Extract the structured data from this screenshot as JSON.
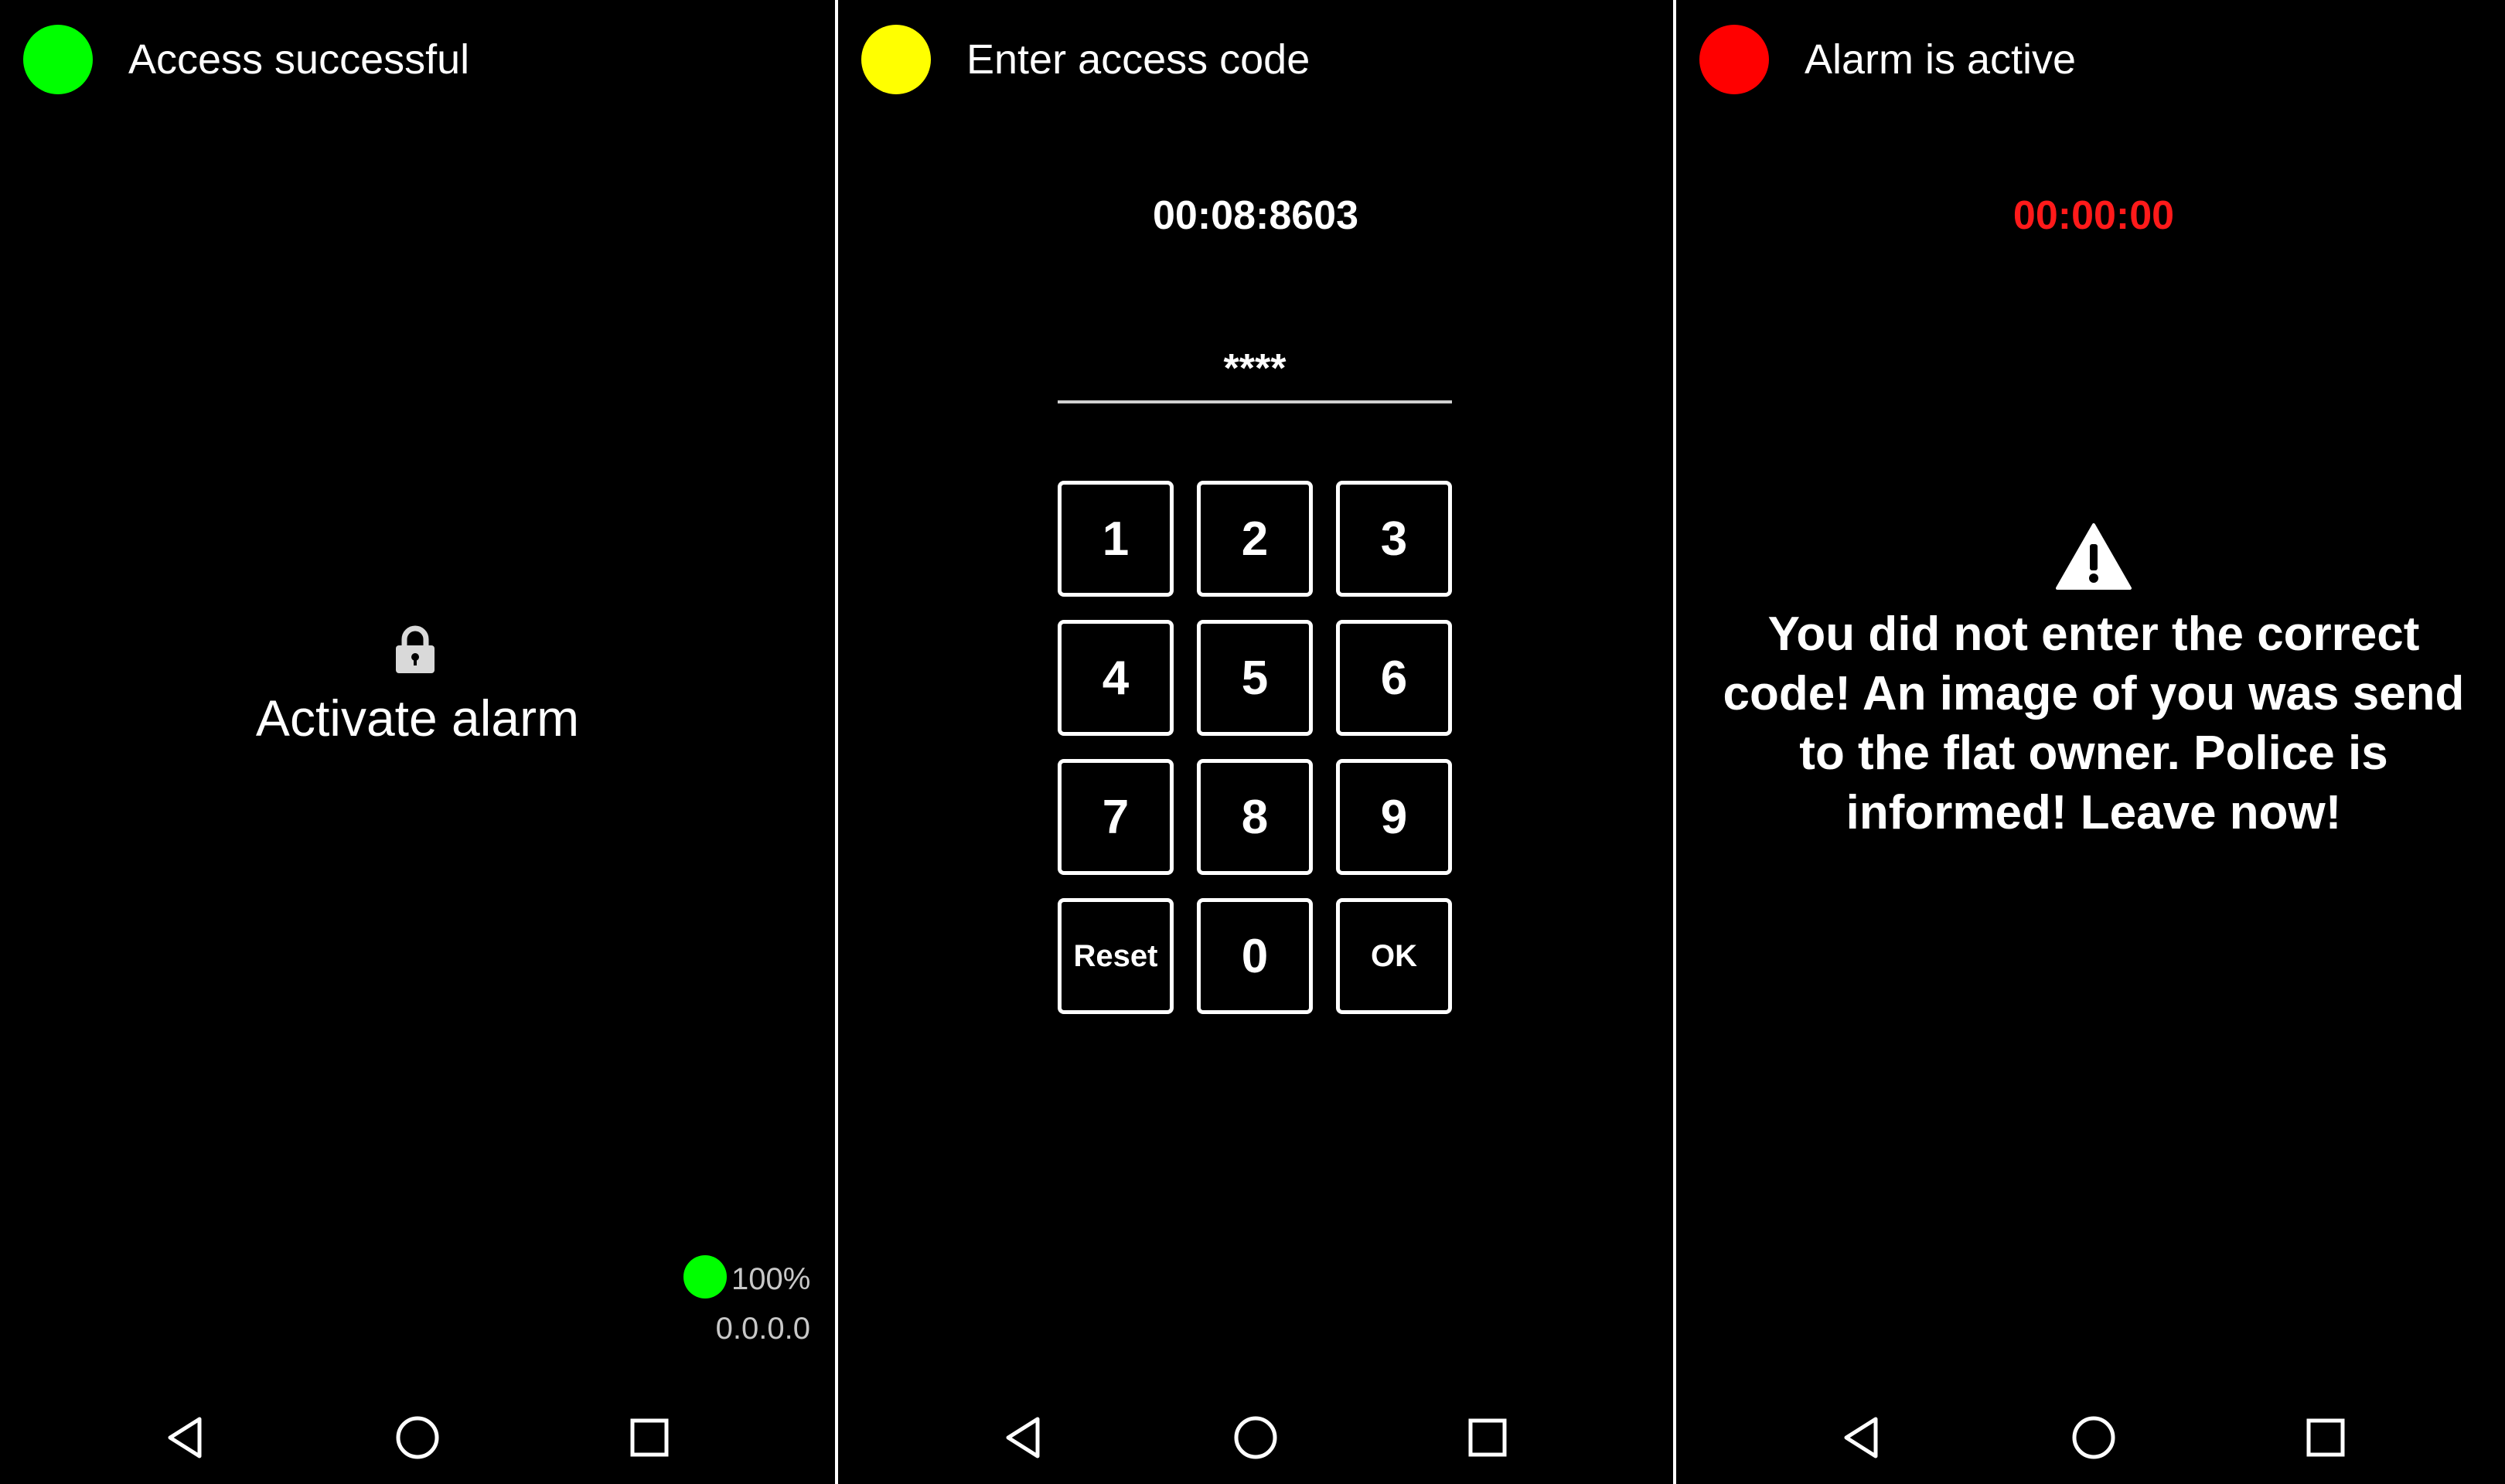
{
  "colors": {
    "green": "#00ff00",
    "yellow": "#ffff00",
    "red": "#ff0000",
    "background": "#000000",
    "text": "#ffffff",
    "timer_alarm": "#ff1a1a"
  },
  "panel1": {
    "status_color": "green",
    "status_text": "Access successful",
    "icon": "lock-icon",
    "action_label": "Activate alarm",
    "battery_indicator_color": "green",
    "battery_percent": "100%",
    "ip_address": "0.0.0.0"
  },
  "panel2": {
    "status_color": "yellow",
    "status_text": "Enter access code",
    "timer": "00:08:8603",
    "code_value": "****",
    "keys": [
      "1",
      "2",
      "3",
      "4",
      "5",
      "6",
      "7",
      "8",
      "9",
      "Reset",
      "0",
      "OK"
    ]
  },
  "panel3": {
    "status_color": "red",
    "status_text": "Alarm is active",
    "timer": "00:00:00",
    "icon": "warning-icon",
    "message": "You did not enter the correct code! An image of you was send to the flat owner. Police is informed! Leave now!"
  },
  "navbar": {
    "icons": [
      "back-icon",
      "home-icon",
      "recent-apps-icon"
    ]
  }
}
